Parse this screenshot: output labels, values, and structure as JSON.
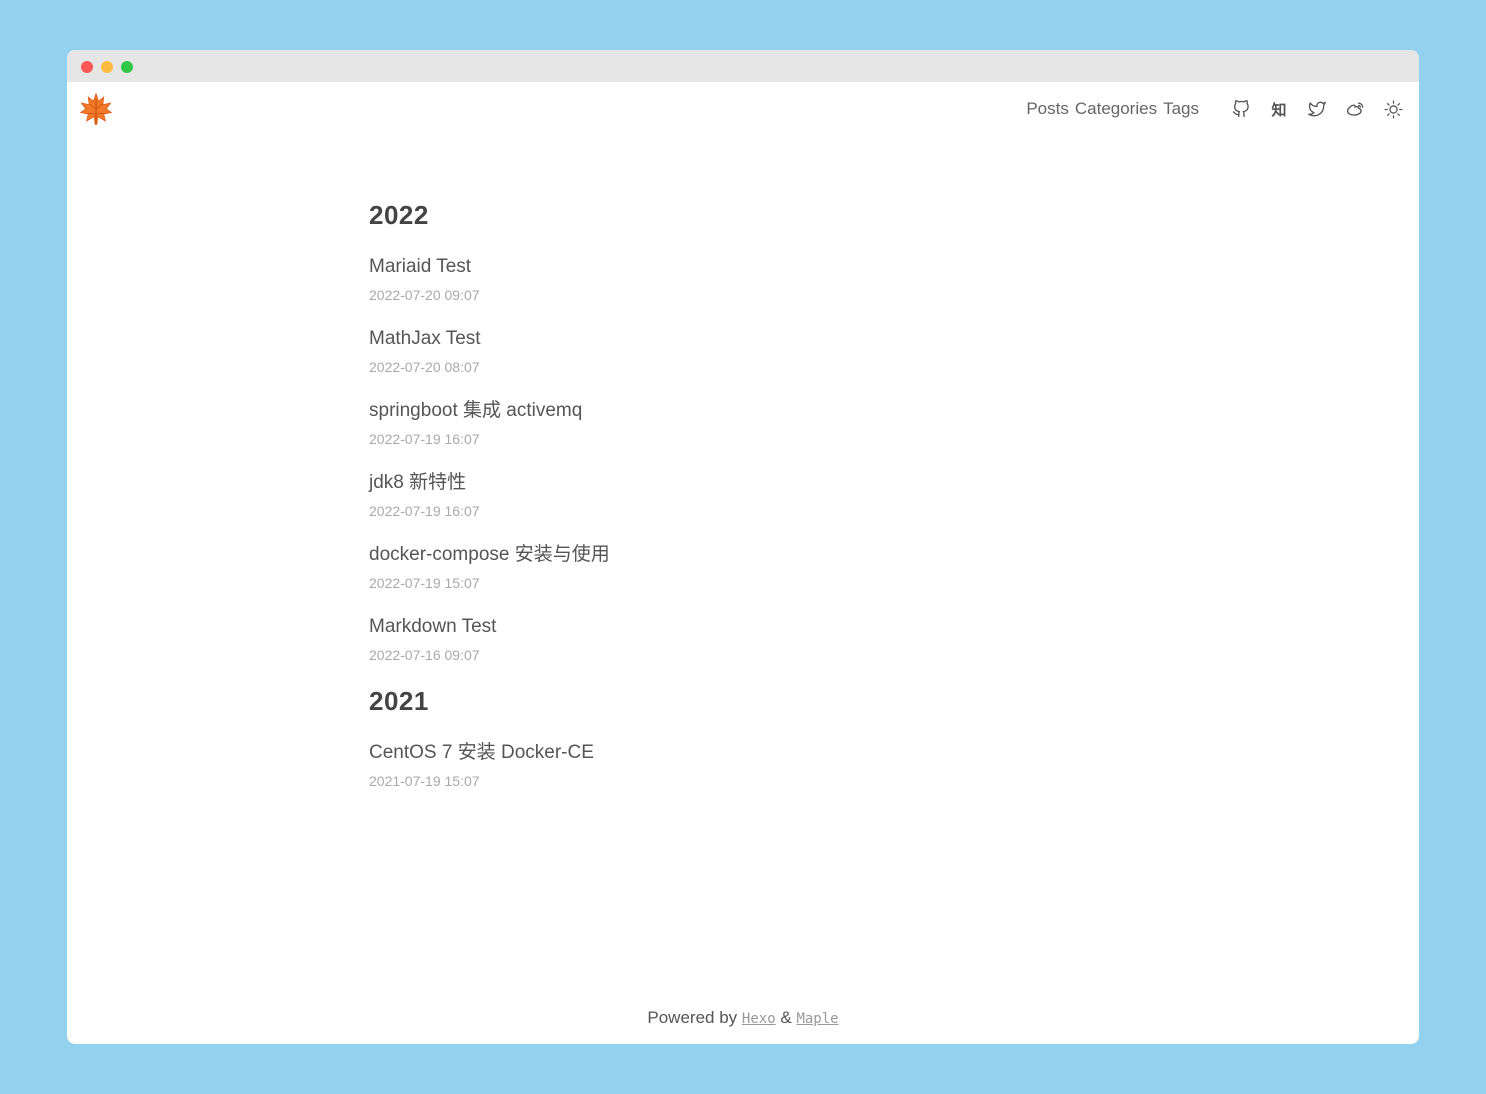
{
  "nav": {
    "links": [
      "Posts",
      "Categories",
      "Tags"
    ],
    "icons": [
      "github-icon",
      "zhihu-icon",
      "twitter-icon",
      "weibo-icon",
      "theme-toggle-icon"
    ],
    "zhihu_glyph": "知"
  },
  "archive": [
    {
      "year": "2022",
      "posts": [
        {
          "title": "Mariaid Test",
          "date": "2022-07-20 09:07"
        },
        {
          "title": "MathJax Test",
          "date": "2022-07-20 08:07"
        },
        {
          "title": "springboot 集成 activemq",
          "date": "2022-07-19 16:07"
        },
        {
          "title": "jdk8 新特性",
          "date": "2022-07-19 16:07"
        },
        {
          "title": "docker-compose 安装与使用",
          "date": "2022-07-19 15:07"
        },
        {
          "title": "Markdown Test",
          "date": "2022-07-16 09:07"
        }
      ]
    },
    {
      "year": "2021",
      "posts": [
        {
          "title": "CentOS 7 安装 Docker-CE",
          "date": "2021-07-19 15:07"
        }
      ]
    }
  ],
  "footer": {
    "prefix": "Powered by",
    "link1": "Hexo",
    "separator": "&",
    "link2": "Maple"
  },
  "colors": {
    "background": "#92d2ef",
    "window": "#ffffff",
    "titlebar": "#e6e6e6",
    "logo": "#f07a2a"
  }
}
